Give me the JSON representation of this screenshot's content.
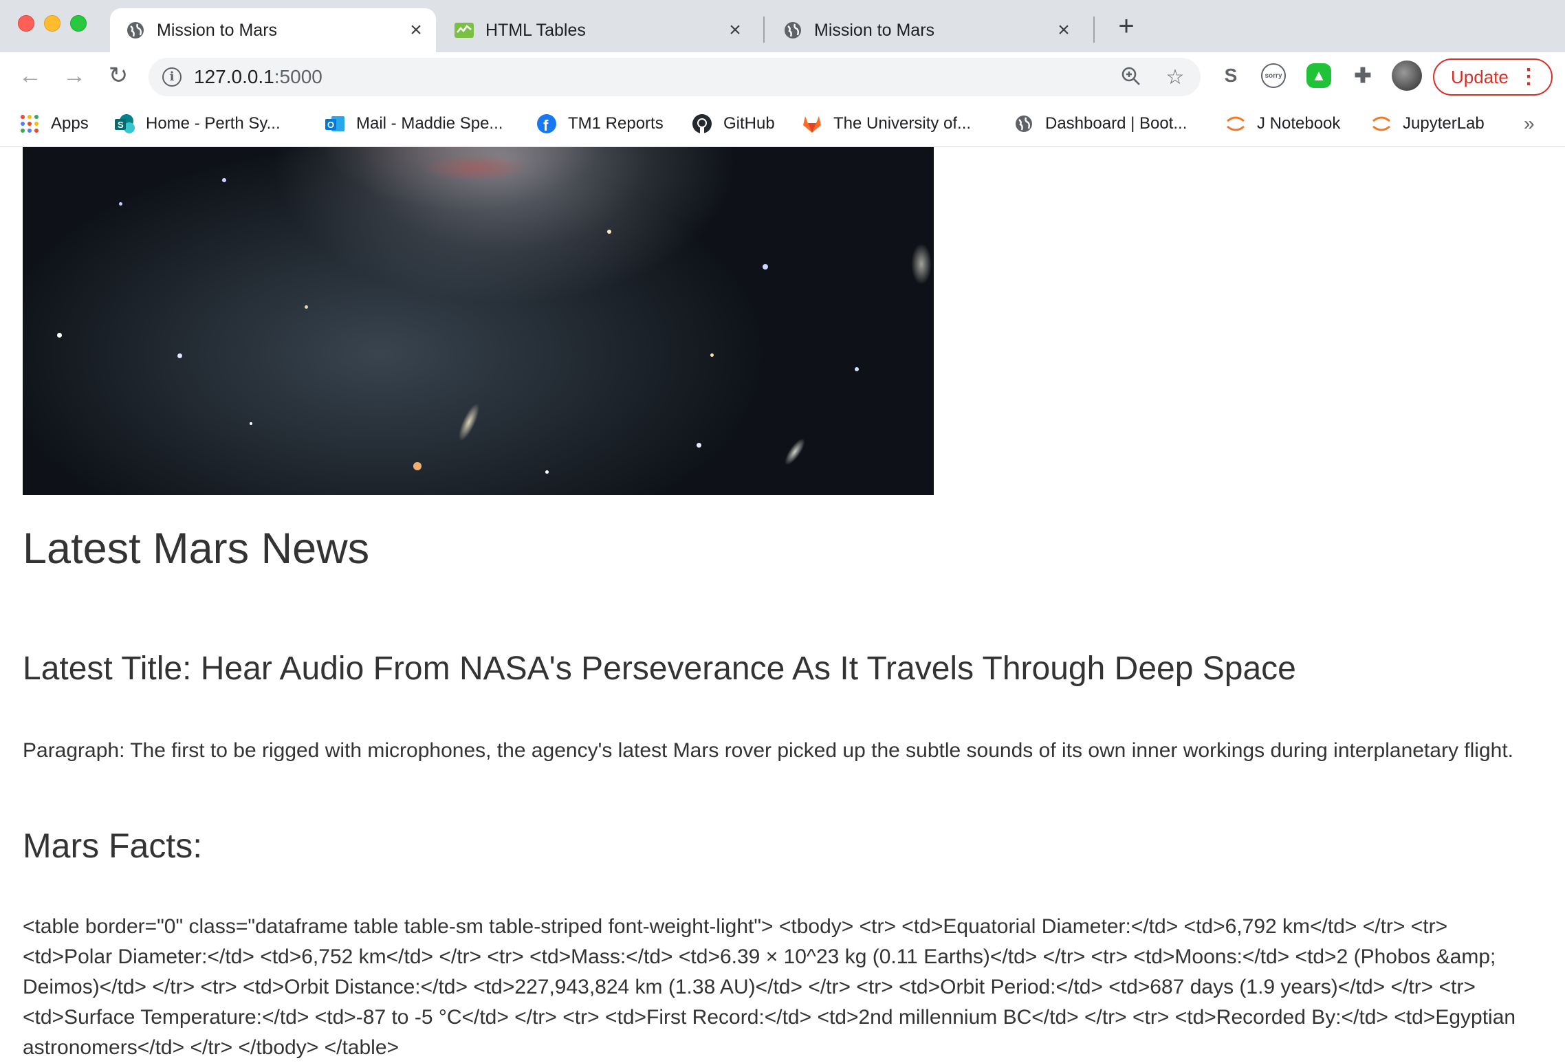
{
  "browser": {
    "tabs": [
      {
        "title": "Mission to Mars",
        "favicon": "globe-icon",
        "active": true
      },
      {
        "title": "HTML Tables",
        "favicon": "html-tables-icon",
        "active": false
      },
      {
        "title": "Mission to Mars",
        "favicon": "globe-icon",
        "active": false
      }
    ],
    "url_host": "127.0.0.1",
    "url_port": ":5000",
    "update_label": "Update",
    "bookmarks": [
      {
        "label": "Apps",
        "icon": "apps-grid-icon"
      },
      {
        "label": "Home - Perth Sy...",
        "icon": "sharepoint-icon"
      },
      {
        "label": "Mail - Maddie Spe...",
        "icon": "outlook-icon"
      },
      {
        "label": "TM1 Reports",
        "icon": "facebook-icon"
      },
      {
        "label": "GitHub",
        "icon": "github-icon"
      },
      {
        "label": "The University of...",
        "icon": "gitlab-icon"
      },
      {
        "label": "Dashboard | Boot...",
        "icon": "globe-icon"
      },
      {
        "label": "J Notebook",
        "icon": "jupyter-icon"
      },
      {
        "label": "JupyterLab",
        "icon": "jupyter-icon"
      }
    ],
    "colors": {
      "tabstrip": "#dee1e6",
      "update_red": "#d93025"
    }
  },
  "page": {
    "news_heading": "Latest Mars News",
    "latest_title": "Latest Title: Hear Audio From NASA's Perseverance As It Travels Through Deep Space",
    "paragraph": "Paragraph: The first to be rigged with microphones, the agency's latest Mars rover picked up the subtle sounds of its own inner workings during interplanetary flight.",
    "facts_heading": "Mars Facts:",
    "facts_raw_html": "<table border=\"0\" class=\"dataframe table table-sm table-striped font-weight-light\"> <tbody> <tr> <td>Equatorial Diameter:</td> <td>6,792 km</td> </tr> <tr> <td>Polar Diameter:</td> <td>6,752 km</td> </tr> <tr> <td>Mass:</td> <td>6.39 × 10^23 kg (0.11 Earths)</td> </tr> <tr> <td>Moons:</td> <td>2 (Phobos &amp; Deimos)</td> </tr> <tr> <td>Orbit Distance:</td> <td>227,943,824 km (1.38 AU)</td> </tr> <tr> <td>Orbit Period:</td> <td>687 days (1.9 years)</td> </tr> <tr> <td>Surface Temperature:</td> <td>-87 to -5 °C</td> </tr> <tr> <td>First Record:</td> <td>2nd millennium BC</td> </tr> <tr> <td>Recorded By:</td> <td>Egyptian astronomers</td> </tr> </tbody> </table>"
  }
}
